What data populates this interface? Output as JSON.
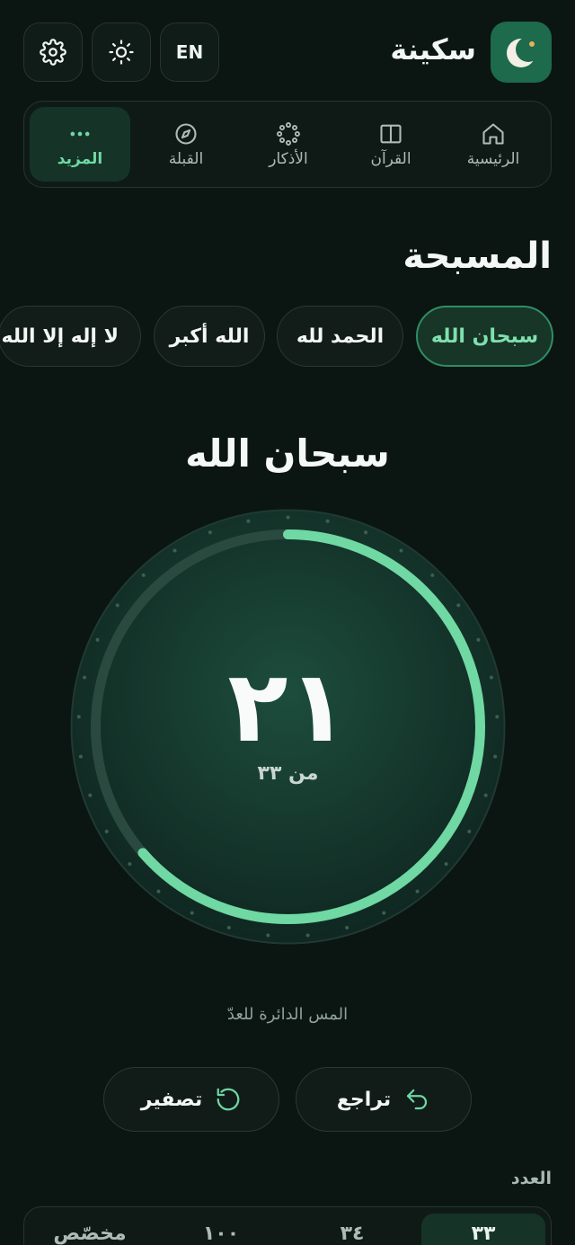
{
  "header": {
    "app_name": "سكينة",
    "lang_button": "EN"
  },
  "nav": {
    "items": [
      {
        "label": "الرئيسية",
        "icon": "home-icon"
      },
      {
        "label": "القرآن",
        "icon": "book-icon"
      },
      {
        "label": "الأذكار",
        "icon": "beads-icon"
      },
      {
        "label": "القبلة",
        "icon": "compass-icon"
      },
      {
        "label": "المزيد",
        "icon": "more-icon",
        "active": true
      }
    ]
  },
  "page_title": "المسبحة",
  "dhikr_options": [
    {
      "label": "سبحان الله",
      "active": true
    },
    {
      "label": "الحمد لله"
    },
    {
      "label": "الله أكبر"
    },
    {
      "label": "لا إله إلا الله"
    }
  ],
  "counter": {
    "dhikr": "سبحان الله",
    "count": "٢١",
    "target_text": "من ٣٣",
    "progress": 0.636,
    "hint": "المس الدائرة للعدّ"
  },
  "actions": {
    "undo": "تراجع",
    "reset": "تصفير"
  },
  "target": {
    "label": "العدد",
    "options": [
      {
        "label": "٣٣",
        "active": true
      },
      {
        "label": "٣٤"
      },
      {
        "label": "١٠٠"
      },
      {
        "label": "مخصّص"
      }
    ]
  },
  "colors": {
    "accent": "#6fd8a3",
    "background": "#0b1512",
    "brand": "#1d6a4c"
  }
}
